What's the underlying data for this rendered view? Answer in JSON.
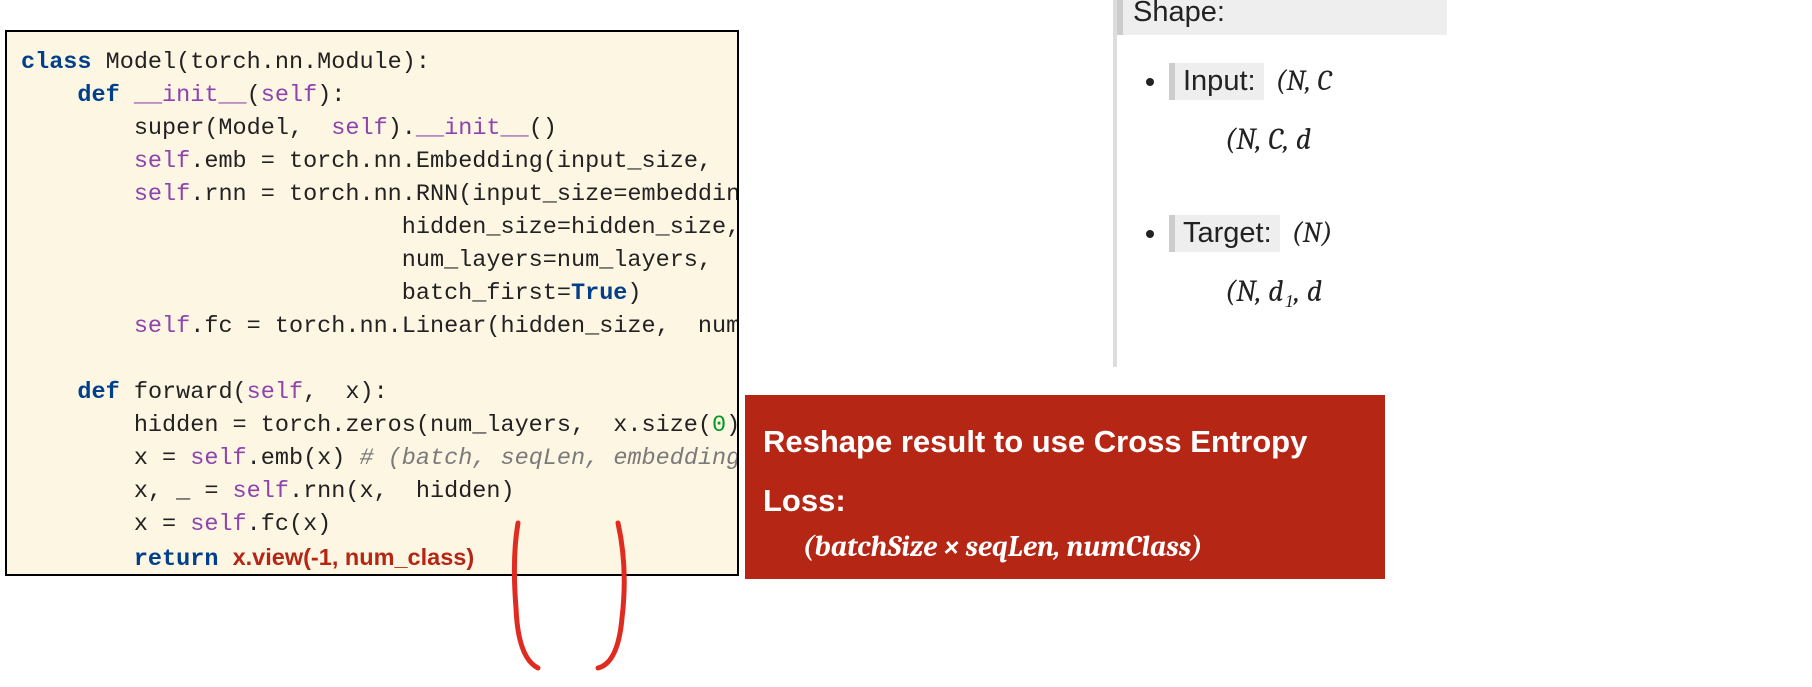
{
  "code": {
    "l1_kw": "class",
    "l1_rest": " Model(torch.nn.Module):",
    "l2_kw": "def",
    "l2_func": "__init__",
    "l2_open": "(",
    "l2_self": "self",
    "l2_close": "):",
    "l3_pre": "        super(Model,  ",
    "l3_self": "self",
    "l3_mid": ").",
    "l3_func": "__init__",
    "l3_end": "()",
    "l4_self": "self",
    "l4_rest": ".emb = torch.nn.Embedding(input_size,  embedding_size)",
    "l5_self": "self",
    "l5_rest": ".rnn = torch.nn.RNN(input_size=embedding_size,",
    "l6": "                           hidden_size=hidden_size,",
    "l7": "                           num_layers=num_layers,",
    "l8a": "                           batch_first=",
    "l8_true": "True",
    "l8b": ")",
    "l9_self": "self",
    "l9_rest": ".fc = torch.nn.Linear(hidden_size,  num_class)",
    "l11_kw": "def",
    "l11_name": " forward(",
    "l11_self": "self",
    "l11_end": ",  x):",
    "l12a": "        hidden = torch.zeros(num_layers,  x.size(",
    "l12_zero": "0",
    "l12b": "),  hidden_size)",
    "l13a": "        x = ",
    "l13_self": "self",
    "l13b": ".emb(x) ",
    "l13_comment": "# (batch, seqLen, embeddingSize)",
    "l14a": "        x, _ = ",
    "l14_self": "self",
    "l14b": ".rnn(x,  hidden)",
    "l15a": "        x = ",
    "l15_self": "self",
    "l15b": ".fc(x)",
    "l16_kw": "return",
    "l16_ret": "x.view(-1, num_class)"
  },
  "callout": {
    "title1": "Reshape result to use Cross Entropy",
    "title2": "Loss:",
    "formula": "(batchSize × seqLen, numClass)"
  },
  "shape": {
    "heading": "Shape:",
    "input_label": "Input:",
    "input_math": "(N, C",
    "input_sub": "(N, C, d",
    "target_label": "Target:",
    "target_math": "(N) ",
    "target_sub": "(N, d₁, d"
  }
}
